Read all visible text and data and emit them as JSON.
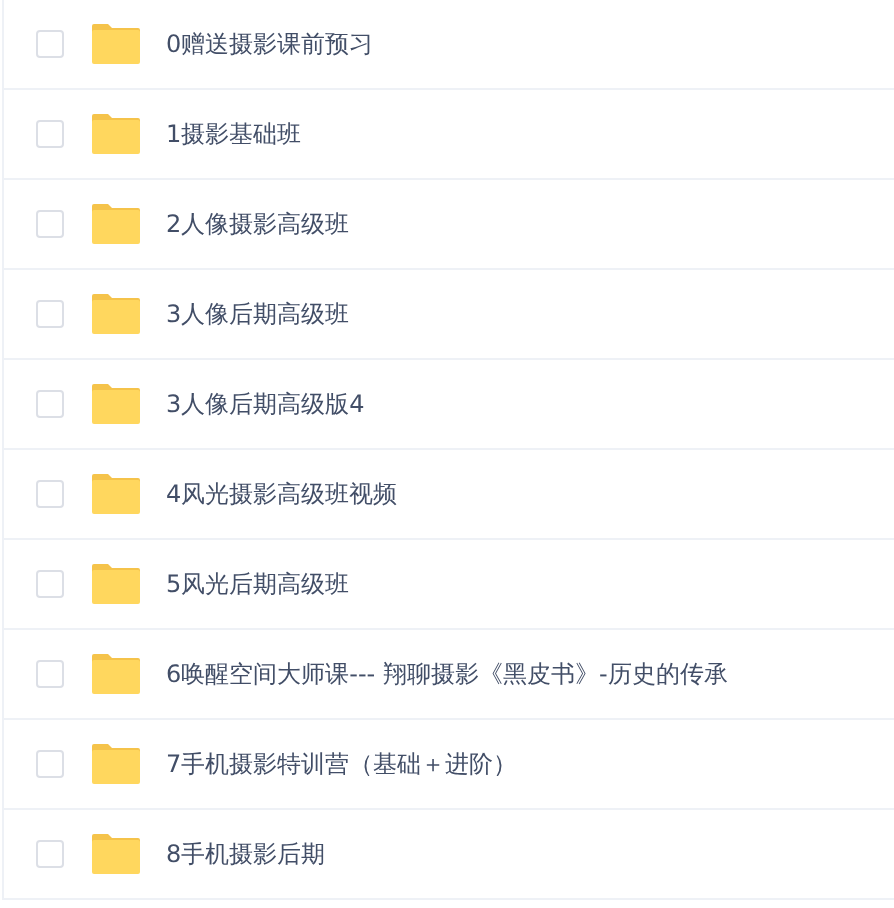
{
  "files": [
    {
      "name": "0赠送摄影课前预习",
      "checked": false
    },
    {
      "name": "1摄影基础班",
      "checked": false
    },
    {
      "name": "2人像摄影高级班",
      "checked": false
    },
    {
      "name": "3人像后期高级班",
      "checked": false
    },
    {
      "name": "3人像后期高级版4",
      "checked": false
    },
    {
      "name": "4风光摄影高级班视频",
      "checked": false
    },
    {
      "name": "5风光后期高级班",
      "checked": false
    },
    {
      "name": "6唤醒空间大师课--- 翔聊摄影《黑皮书》-历史的传承",
      "checked": false
    },
    {
      "name": "7手机摄影特训营（基础＋进阶）",
      "checked": false
    },
    {
      "name": "8手机摄影后期",
      "checked": false
    }
  ]
}
